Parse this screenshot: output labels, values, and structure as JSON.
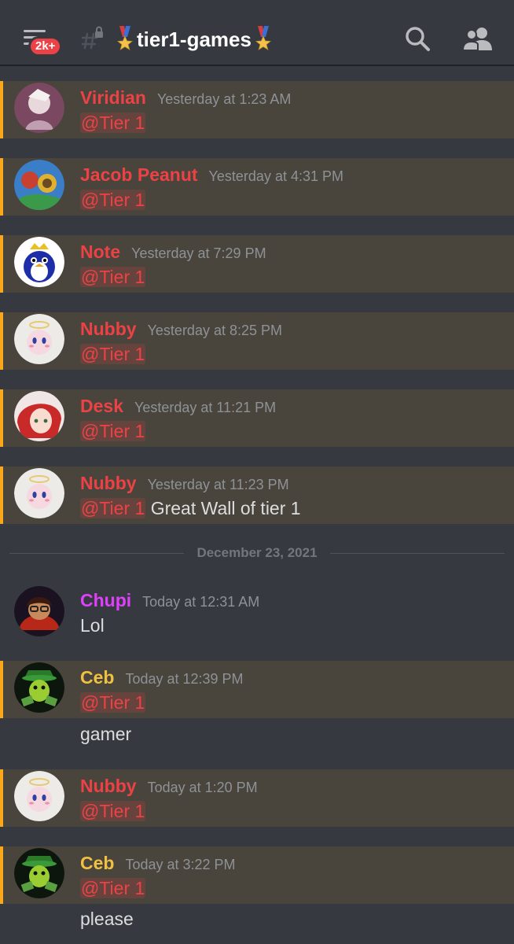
{
  "header": {
    "unread_badge": "2k+",
    "channel_name": "tier1-games",
    "icons": [
      "hamburger-icon",
      "locked-channel-icon",
      "medal-icon",
      "search-icon",
      "members-icon"
    ]
  },
  "colors": {
    "background": "#36393f",
    "highlight_bg": "#49443c",
    "highlight_bar": "#faa81a",
    "mention": "#ed4245",
    "username_red": "#ed4245",
    "username_purple": "#e040fb",
    "username_gold": "#f0c040",
    "timestamp": "#8e9297"
  },
  "messages": [
    {
      "username": "Viridian",
      "timestamp": "Yesterday at 1:23 AM",
      "mention": "@Tier 1",
      "text": ""
    },
    {
      "username": "Jacob Peanut",
      "timestamp": "Yesterday at 4:31 PM",
      "mention": "@Tier 1",
      "text": ""
    },
    {
      "username": "Note",
      "timestamp": "Yesterday at 7:29 PM",
      "mention": "@Tier 1",
      "text": ""
    },
    {
      "username": "Nubby",
      "timestamp": "Yesterday at 8:25 PM",
      "mention": "@Tier 1",
      "text": ""
    },
    {
      "username": "Desk",
      "timestamp": "Yesterday at 11:21 PM",
      "mention": "@Tier 1",
      "text": ""
    },
    {
      "username": "Nubby",
      "timestamp": "Yesterday at 11:23 PM",
      "mention": "@Tier 1",
      "text": "Great Wall of tier 1"
    },
    {
      "username": "Chupi",
      "timestamp": "Today at 12:31 AM",
      "mention": "",
      "text": "Lol"
    },
    {
      "username": "Ceb",
      "timestamp": "Today at 12:39 PM",
      "mention": "@Tier 1",
      "text": "",
      "followup": "gamer"
    },
    {
      "username": "Nubby",
      "timestamp": "Today at 1:20 PM",
      "mention": "@Tier 1",
      "text": ""
    },
    {
      "username": "Ceb",
      "timestamp": "Today at 3:22 PM",
      "mention": "@Tier 1",
      "text": "",
      "followup": "please"
    }
  ],
  "date_divider": "December 23, 2021"
}
